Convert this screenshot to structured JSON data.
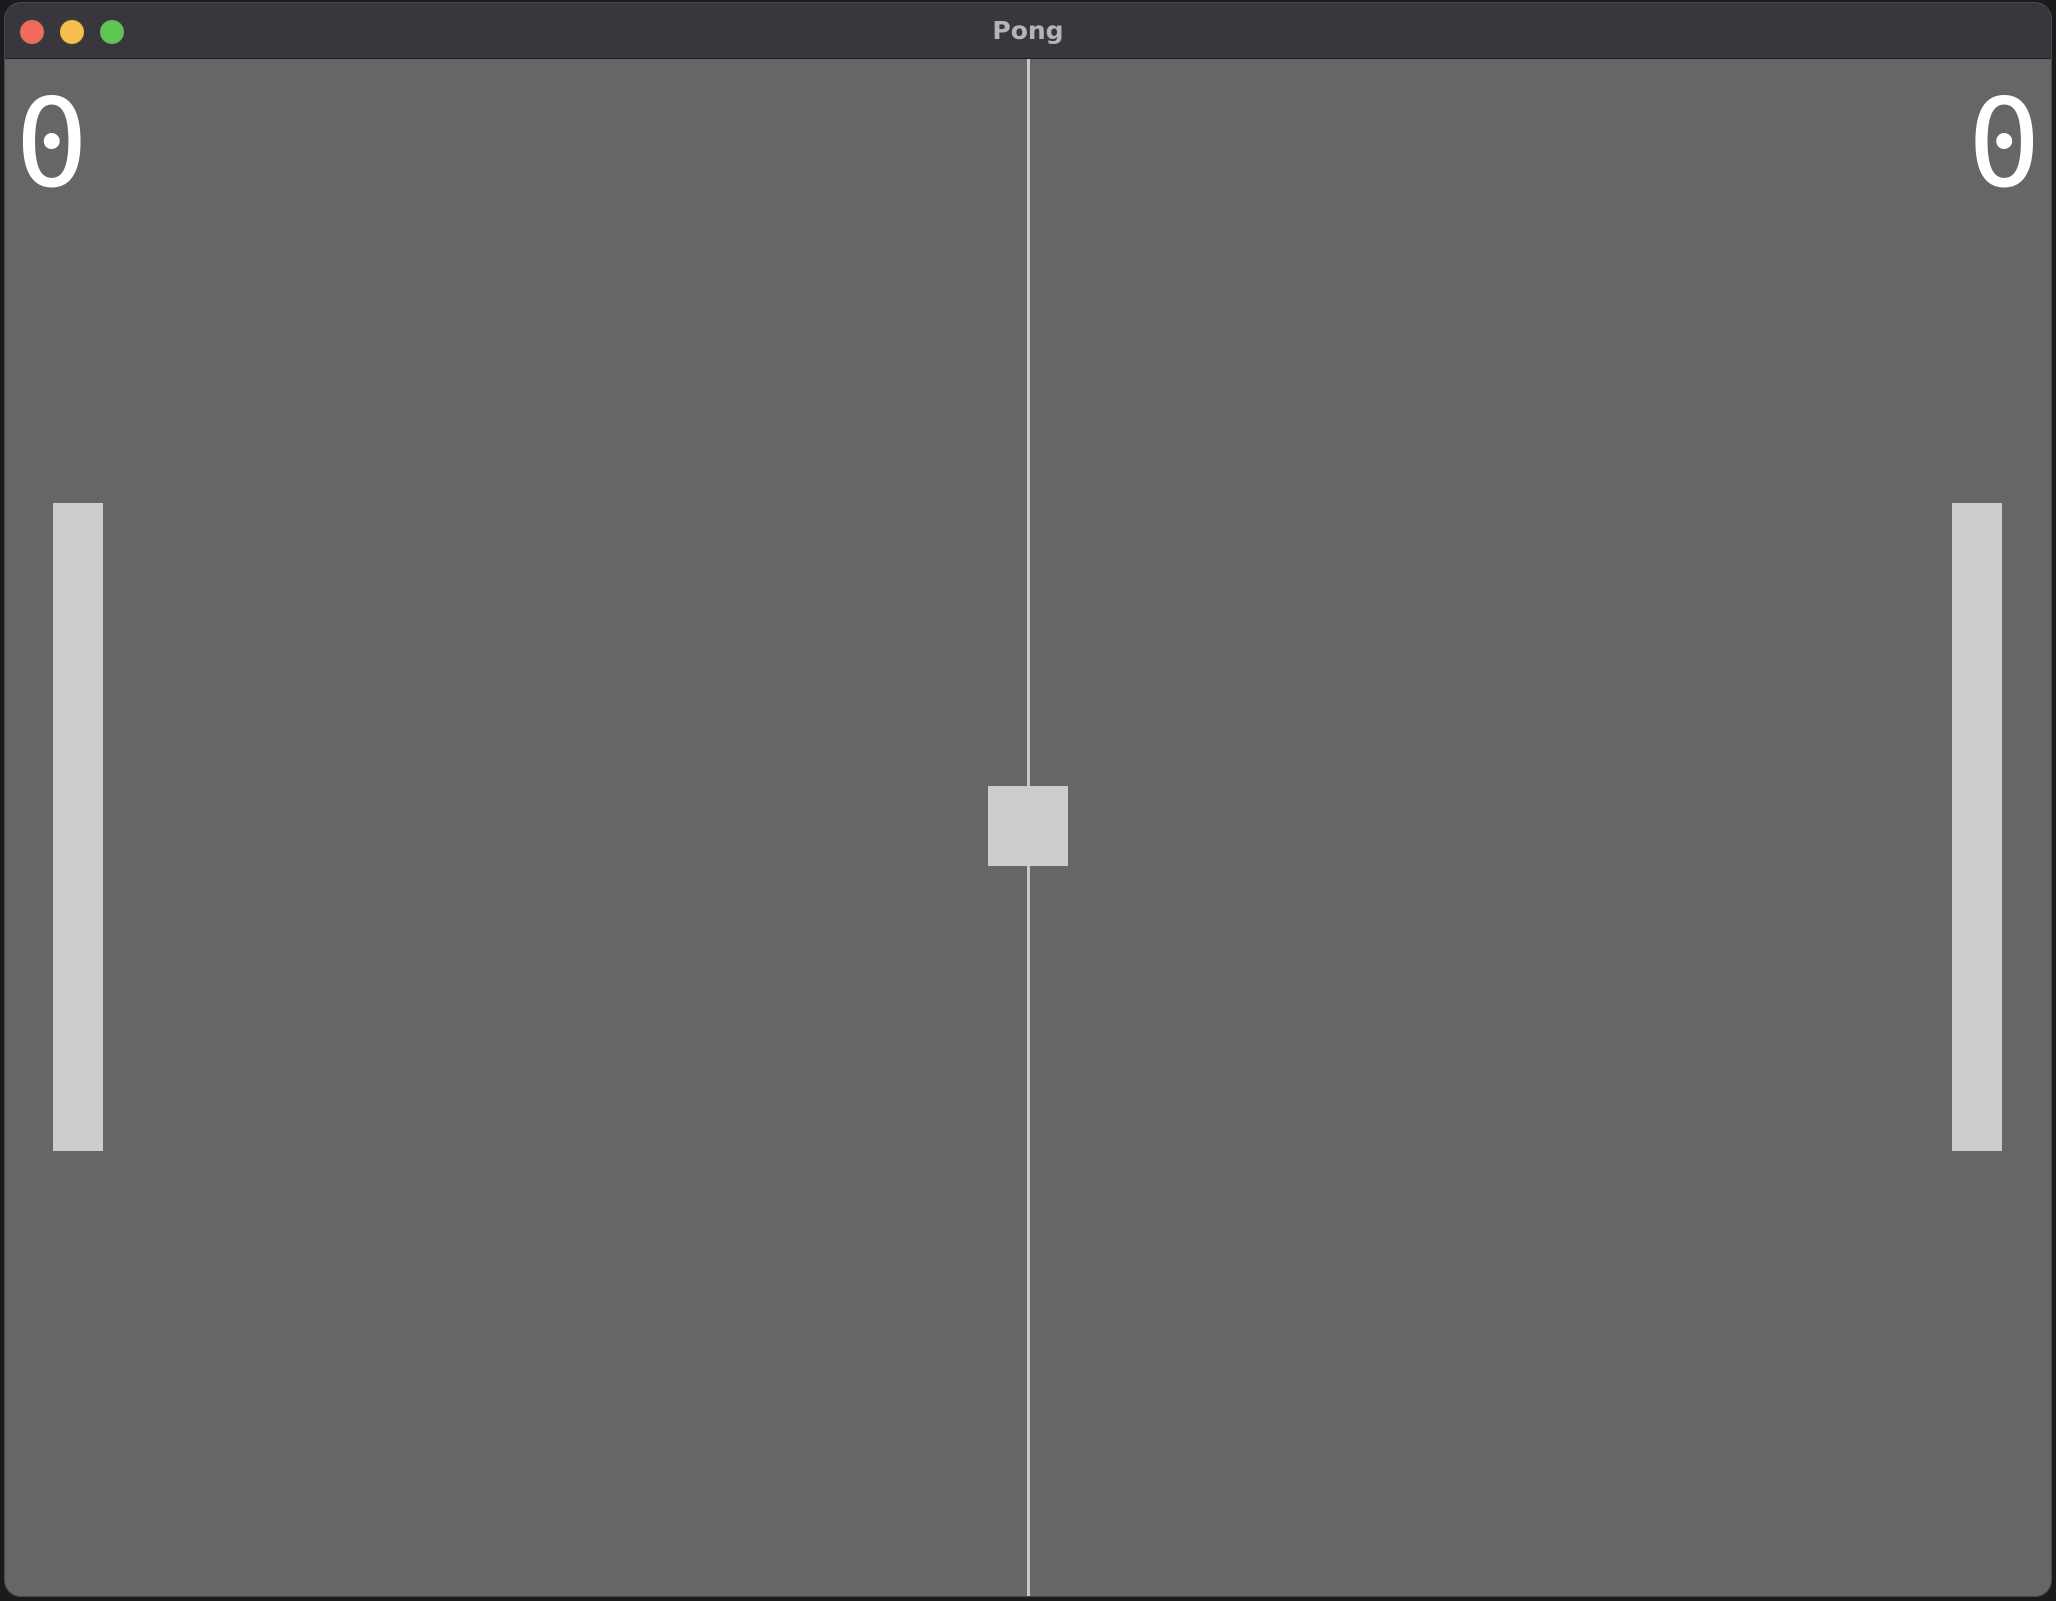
{
  "window": {
    "title": "Pong",
    "controls": {
      "close_color": "#ec6a5e",
      "minimize_color": "#f4bf4f",
      "zoom_color": "#61c554"
    }
  },
  "game": {
    "score_left": "0",
    "score_right": "0",
    "colors": {
      "court": "#666666",
      "paddle": "#cccccc",
      "ball": "#cccccc",
      "net": "#c8c8c8",
      "score": "#ffffff"
    }
  }
}
